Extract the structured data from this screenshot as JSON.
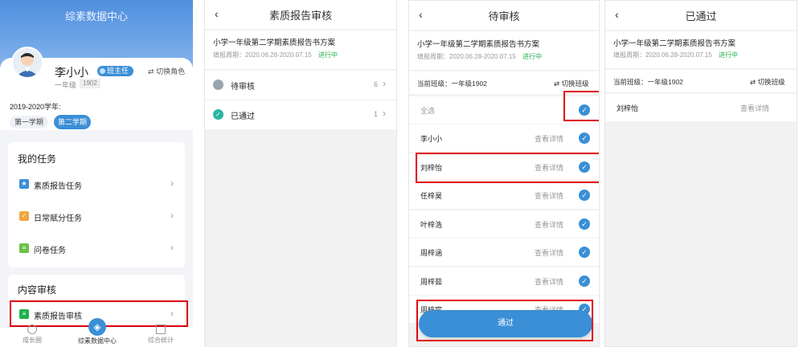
{
  "panel1": {
    "app_title": "综素数据中心",
    "user_name": "李小小",
    "role_badge": "班主任",
    "switch_role": "切换角色",
    "grade": "一年级",
    "class_no": "1902",
    "school_year": "2019-2020学年:",
    "term1": "第一学期",
    "term2": "第二学期",
    "my_tasks_title": "我的任务",
    "tasks": [
      "素质报告任务",
      "日常赋分任务",
      "问卷任务"
    ],
    "review_title": "内容审核",
    "review_item": "素质报告审核",
    "nav": [
      "成长圈",
      "综素数据中心",
      "综合统计"
    ]
  },
  "panel2": {
    "title": "素质报告审核",
    "plan_title": "小学一年级第二学期素质报告书方案",
    "period_label": "填报周期：2020.06.28-2020.07.15",
    "status": "进行中",
    "rows": [
      {
        "label": "待审核",
        "count": "6"
      },
      {
        "label": "已通过",
        "count": "1"
      }
    ]
  },
  "panel3": {
    "title": "待审核",
    "plan_title": "小学一年级第二学期素质报告书方案",
    "period_label": "填报周期：2020.06.28-2020.07.15",
    "status": "进行中",
    "current_class": "当前班级：一年级1902",
    "switch_class": "切换班级",
    "select_all": "全选",
    "view_detail": "查看详情",
    "students": [
      "李小小",
      "刘梓怡",
      "任梓昊",
      "叶梓浩",
      "周梓涵",
      "周梓茹",
      "周梓宸"
    ],
    "pass_button": "通过"
  },
  "panel4": {
    "title": "已通过",
    "plan_title": "小学一年级第二学期素质报告书方案",
    "period_label": "填报周期：2020.06.28-2020.07.15",
    "status": "进行中",
    "current_class": "当前班级：一年级1902",
    "switch_class": "切换班级",
    "students": [
      "刘梓怡"
    ],
    "view_detail": "查看详情"
  },
  "colors": {
    "blue": "#3a8fd6",
    "header_blue": "#5b9be3",
    "green": "#21b04b",
    "red_highlight": "#e0000e"
  }
}
